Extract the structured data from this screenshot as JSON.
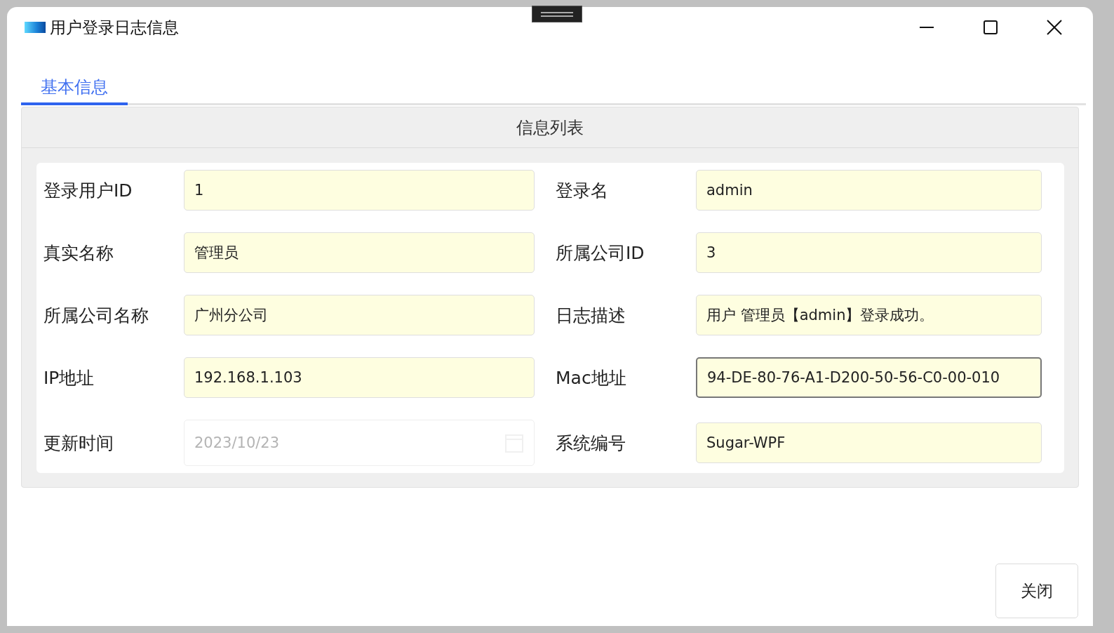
{
  "window": {
    "title": "用户登录日志信息"
  },
  "tabs": [
    {
      "label": "基本信息",
      "selected": true
    }
  ],
  "group": {
    "title": "信息列表"
  },
  "fields": [
    {
      "label": "登录用户ID",
      "value": "1",
      "kind": "text",
      "disabled": false,
      "focused": false
    },
    {
      "label": "登录名",
      "value": "admin",
      "kind": "text",
      "disabled": false,
      "focused": false
    },
    {
      "label": "真实名称",
      "value": "管理员",
      "kind": "text",
      "disabled": false,
      "focused": false
    },
    {
      "label": "所属公司ID",
      "value": "3",
      "kind": "text",
      "disabled": false,
      "focused": false
    },
    {
      "label": "所属公司名称",
      "value": "广州分公司",
      "kind": "text",
      "disabled": false,
      "focused": false
    },
    {
      "label": "日志描述",
      "value": "用户 管理员【admin】登录成功。",
      "kind": "text",
      "disabled": false,
      "focused": false
    },
    {
      "label": "IP地址",
      "value": "192.168.1.103",
      "kind": "text",
      "disabled": false,
      "focused": false
    },
    {
      "label": "Mac地址",
      "value": "94-DE-80-76-A1-D200-50-56-C0-00-010",
      "kind": "text",
      "disabled": false,
      "focused": true
    },
    {
      "label": "更新时间",
      "value": "2023/10/23",
      "kind": "date",
      "disabled": true,
      "focused": false
    },
    {
      "label": "系统编号",
      "value": "Sugar-WPF",
      "kind": "text",
      "disabled": false,
      "focused": false
    }
  ],
  "buttons": [
    {
      "label": "关闭"
    }
  ]
}
